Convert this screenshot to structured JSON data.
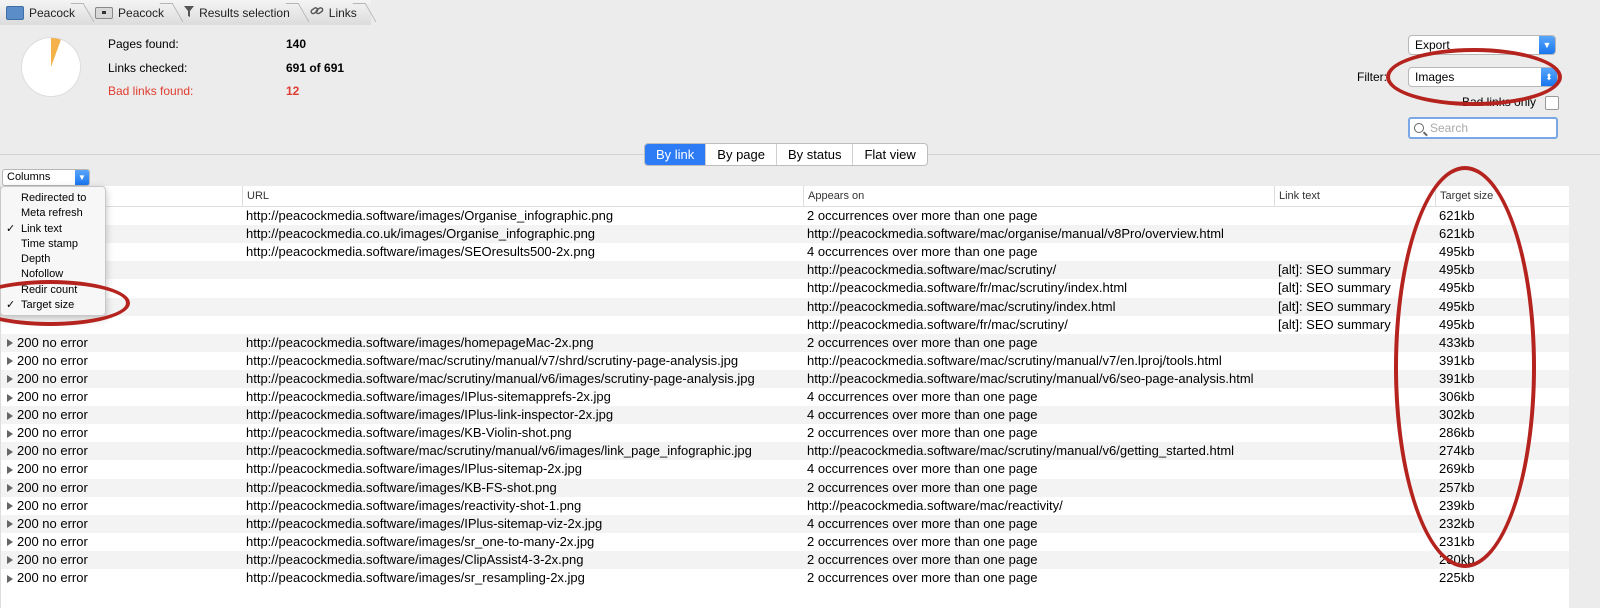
{
  "breadcrumb": [
    {
      "label": "Peacock",
      "icon": "folder-icon"
    },
    {
      "label": "Peacock",
      "icon": "drive-icon"
    },
    {
      "label": "Results selection",
      "icon": "filter-icon"
    },
    {
      "label": "Links",
      "icon": "link-icon"
    }
  ],
  "stats": {
    "pages_found_label": "Pages found:",
    "pages_found_value": "140",
    "links_checked_label": "Links checked:",
    "links_checked_value": "691 of 691",
    "bad_links_label": "Bad links found:",
    "bad_links_value": "12"
  },
  "controls": {
    "export_label": "Export",
    "filter_label": "Filter:",
    "filter_value": "Images",
    "bad_links_only_label": "Bad links only",
    "search_placeholder": "Search"
  },
  "view_tabs": [
    "By link",
    "By page",
    "By status",
    "Flat view"
  ],
  "columns_button": "Columns",
  "columns_menu": [
    {
      "label": "Redirected to",
      "checked": false
    },
    {
      "label": "Meta refresh",
      "checked": false
    },
    {
      "label": "Link text",
      "checked": true
    },
    {
      "label": "Time stamp",
      "checked": false
    },
    {
      "label": "Depth",
      "checked": false
    },
    {
      "label": "Nofollow",
      "checked": false
    },
    {
      "label": "Redir count",
      "checked": false
    },
    {
      "label": "Target size",
      "checked": true
    }
  ],
  "table": {
    "headers": [
      "URL",
      "Appears on",
      "Link text",
      "Target size"
    ],
    "rows": [
      {
        "status": "",
        "url": "http://peacockmedia.software/images/Organise_infographic.png",
        "appears": "2 occurrences over more than one page",
        "text": "",
        "size": "621kb"
      },
      {
        "status": "",
        "url": "http://peacockmedia.co.uk/images/Organise_infographic.png",
        "appears": "http://peacockmedia.software/mac/organise/manual/v8Pro/overview.html",
        "text": "",
        "size": "621kb"
      },
      {
        "status": "",
        "url": "http://peacockmedia.software/images/SEOresults500-2x.png",
        "appears": "4 occurrences over more than one page",
        "text": "",
        "size": "495kb"
      },
      {
        "status": "",
        "url": "",
        "appears": "http://peacockmedia.software/mac/scrutiny/",
        "text": "[alt]: SEO summary",
        "size": "495kb"
      },
      {
        "status": "",
        "url": "",
        "appears": "http://peacockmedia.software/fr/mac/scrutiny/index.html",
        "text": "[alt]: SEO summary",
        "size": "495kb"
      },
      {
        "status": "",
        "url": "",
        "appears": "http://peacockmedia.software/mac/scrutiny/index.html",
        "text": "[alt]: SEO summary",
        "size": "495kb"
      },
      {
        "status": "",
        "url": "",
        "appears": "http://peacockmedia.software/fr/mac/scrutiny/",
        "text": "[alt]: SEO summary",
        "size": "495kb"
      },
      {
        "status": "200 no error",
        "url": "http://peacockmedia.software/images/homepageMac-2x.png",
        "appears": "2 occurrences over more than one page",
        "text": "",
        "size": "433kb"
      },
      {
        "status": "200 no error",
        "url": "http://peacockmedia.software/mac/scrutiny/manual/v7/shrd/scrutiny-page-analysis.jpg",
        "appears": "http://peacockmedia.software/mac/scrutiny/manual/v7/en.lproj/tools.html",
        "text": "",
        "size": "391kb"
      },
      {
        "status": "200 no error",
        "url": "http://peacockmedia.software/mac/scrutiny/manual/v6/images/scrutiny-page-analysis.jpg",
        "appears": "http://peacockmedia.software/mac/scrutiny/manual/v6/seo-page-analysis.html",
        "text": "",
        "size": "391kb"
      },
      {
        "status": "200 no error",
        "url": "http://peacockmedia.software/images/IPlus-sitemapprefs-2x.jpg",
        "appears": "4 occurrences over more than one page",
        "text": "",
        "size": "306kb"
      },
      {
        "status": "200 no error",
        "url": "http://peacockmedia.software/images/IPlus-link-inspector-2x.jpg",
        "appears": "4 occurrences over more than one page",
        "text": "",
        "size": "302kb"
      },
      {
        "status": "200 no error",
        "url": "http://peacockmedia.software/images/KB-Violin-shot.png",
        "appears": "2 occurrences over more than one page",
        "text": "",
        "size": "286kb"
      },
      {
        "status": "200 no error",
        "url": "http://peacockmedia.software/mac/scrutiny/manual/v6/images/link_page_infographic.jpg",
        "appears": "http://peacockmedia.software/mac/scrutiny/manual/v6/getting_started.html",
        "text": "",
        "size": "274kb"
      },
      {
        "status": "200 no error",
        "url": "http://peacockmedia.software/images/IPlus-sitemap-2x.jpg",
        "appears": "4 occurrences over more than one page",
        "text": "",
        "size": "269kb"
      },
      {
        "status": "200 no error",
        "url": "http://peacockmedia.software/images/KB-FS-shot.png",
        "appears": "2 occurrences over more than one page",
        "text": "",
        "size": "257kb"
      },
      {
        "status": "200 no error",
        "url": "http://peacockmedia.software/images/reactivity-shot-1.png",
        "appears": "http://peacockmedia.software/mac/reactivity/",
        "text": "",
        "size": "239kb"
      },
      {
        "status": "200 no error",
        "url": "http://peacockmedia.software/images/IPlus-sitemap-viz-2x.jpg",
        "appears": "4 occurrences over more than one page",
        "text": "",
        "size": "232kb"
      },
      {
        "status": "200 no error",
        "url": "http://peacockmedia.software/images/sr_one-to-many-2x.jpg",
        "appears": "2 occurrences over more than one page",
        "text": "",
        "size": "231kb"
      },
      {
        "status": "200 no error",
        "url": "http://peacockmedia.software/images/ClipAssist4-3-2x.png",
        "appears": "2 occurrences over more than one page",
        "text": "",
        "size": "230kb"
      },
      {
        "status": "200 no error",
        "url": "http://peacockmedia.software/images/sr_resampling-2x.jpg",
        "appears": "2 occurrences over more than one page",
        "text": "",
        "size": "225kb"
      }
    ]
  }
}
